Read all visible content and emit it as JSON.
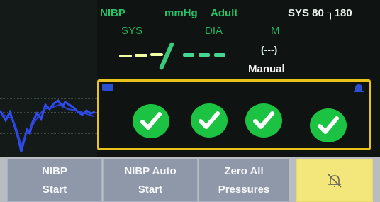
{
  "header": {
    "mode": "NIBP",
    "unit": "mmHg",
    "patient": "Adult",
    "alarm_limits": "SYS 80 ┐180"
  },
  "labels": {
    "sys": "SYS",
    "dia": "DIA",
    "mean": "M"
  },
  "values": {
    "mean": "(---)",
    "measurement_mode": "Manual"
  },
  "checks": [
    {
      "name": "check-1",
      "icon": "checkmark-icon"
    },
    {
      "name": "check-2",
      "icon": "checkmark-icon"
    },
    {
      "name": "check-3",
      "icon": "checkmark-icon"
    },
    {
      "name": "check-4",
      "icon": "checkmark-icon"
    }
  ],
  "buttons": {
    "nibp_start_line1": "NIBP",
    "nibp_start_line2": "Start",
    "nibp_auto_line1": "NIBP Auto",
    "nibp_auto_line2": "Start",
    "zero_line1": "Zero All",
    "zero_line2": "Pressures",
    "alarm_icon": "alarm-silenced-icon"
  },
  "colors": {
    "label_green": "#27c16a",
    "check_green": "#1cc242",
    "panel_border": "#e9c21c",
    "button_gray": "#8f98a9",
    "alarm_yellow": "#f3e77b"
  }
}
